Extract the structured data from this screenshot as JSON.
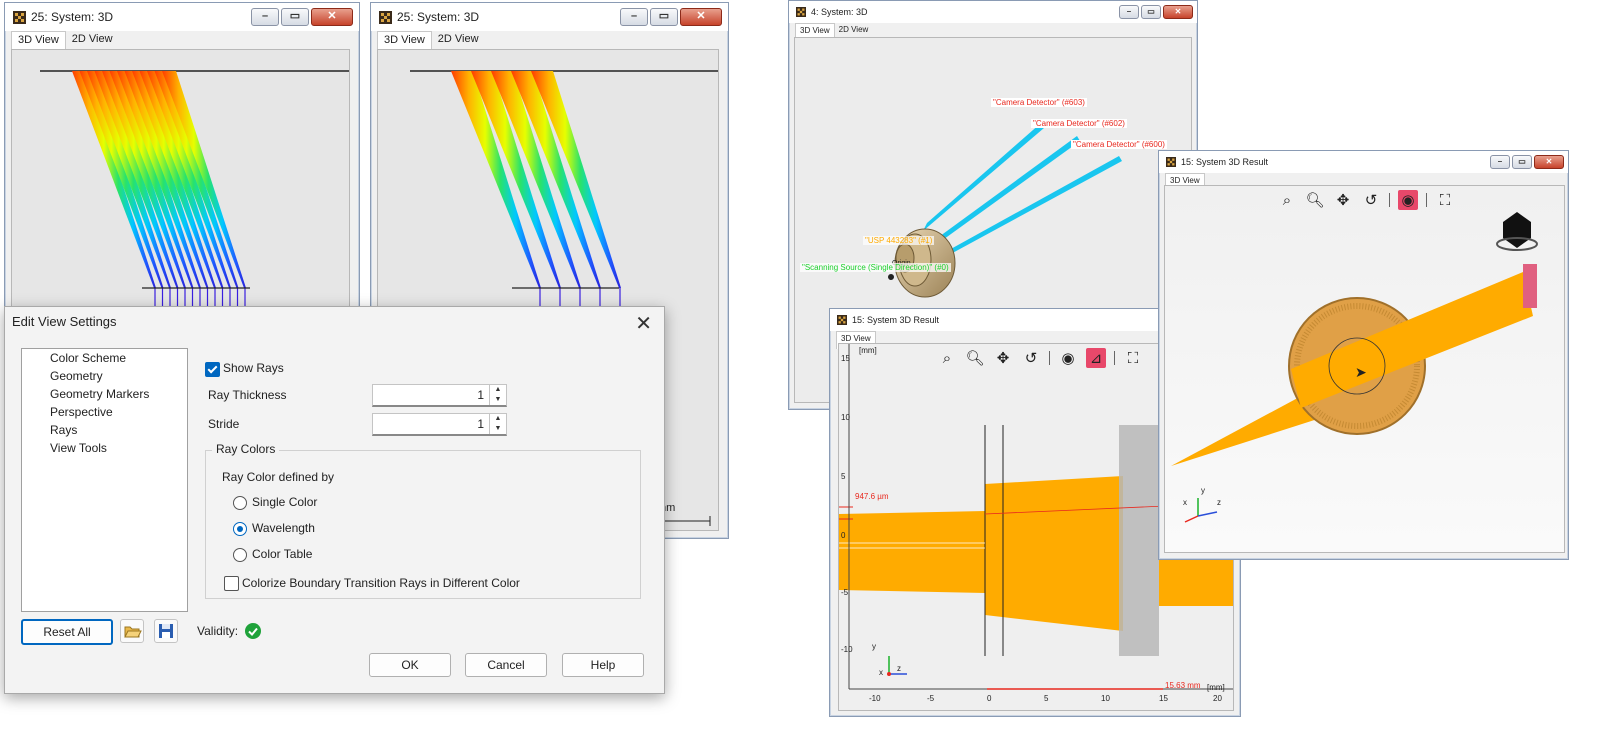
{
  "win1": {
    "title": "25: System: 3D",
    "tabs": [
      "3D View",
      "2D View"
    ]
  },
  "win2": {
    "title": "25: System: 3D",
    "tabs": [
      "3D View",
      "2D View"
    ],
    "unit_fragment": "nm"
  },
  "win4": {
    "title": "4: System: 3D",
    "tabs": [
      "3D View",
      "2D View"
    ],
    "labels": {
      "det603": "\"Camera Detector\" (#603)",
      "det602": "\"Camera Detector\" (#602)",
      "det600": "\"Camera Detector\" (#600)",
      "usp": "\"USP 443283\" (#1)",
      "origin": "Origin",
      "source": "\"Scanning Source (Single Direction)\" (#0)"
    }
  },
  "win15a": {
    "title": "15: System 3D Result",
    "tabs": [
      "3D View"
    ],
    "axis": {
      "unit": "[mm]",
      "y_ticks": [
        "15",
        "10",
        "5",
        "0",
        "-5",
        "-10"
      ],
      "x_ticks": [
        "-10",
        "-5",
        "0",
        "5",
        "10",
        "15",
        "20"
      ],
      "measure_y": "947.6 µm",
      "measure_x": "15.63 mm",
      "y": "y",
      "z": "z",
      "x": "x"
    }
  },
  "win15b": {
    "title": "15: System 3D Result",
    "tabs": [
      "3D View"
    ],
    "axes": {
      "x": "x",
      "y": "y",
      "z": "z"
    }
  },
  "dialog": {
    "title": "Edit View Settings",
    "nav": [
      "Color Scheme",
      "Geometry",
      "Geometry Markers",
      "Perspective",
      "Rays",
      "View Tools"
    ],
    "show_rays": "Show Rays",
    "ray_thickness_label": "Ray Thickness",
    "ray_thickness_value": "1",
    "stride_label": "Stride",
    "stride_value": "1",
    "ray_colors_group": "Ray Colors",
    "ray_color_defined_by": "Ray Color defined by",
    "options": [
      "Single Color",
      "Wavelength",
      "Color Table"
    ],
    "selected_option": "Wavelength",
    "colorize_label": "Colorize Boundary Transition Rays in Different Color",
    "reset_all": "Reset All",
    "validity": "Validity:",
    "ok": "OK",
    "cancel": "Cancel",
    "help": "Help"
  },
  "colors": {
    "accent": "#0067c0",
    "beam": "#ffab00",
    "cyan_beam": "#19c6ef",
    "red_label": "#e8281e",
    "green_label": "#1bd12b"
  }
}
